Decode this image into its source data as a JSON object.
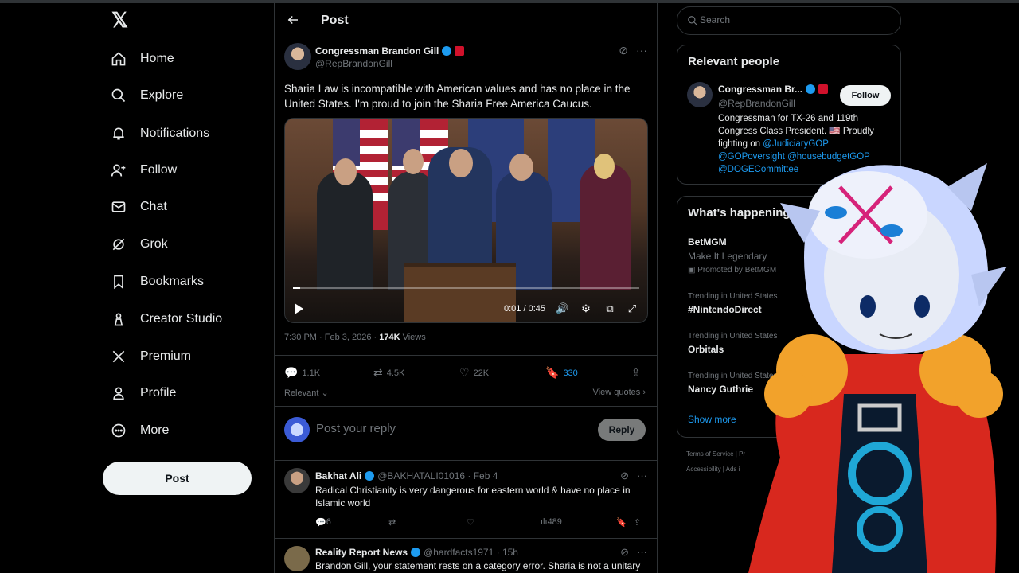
{
  "nav": {
    "items": [
      {
        "label": "Home",
        "icon": "home-icon"
      },
      {
        "label": "Explore",
        "icon": "search-icon"
      },
      {
        "label": "Notifications",
        "icon": "bell-icon"
      },
      {
        "label": "Follow",
        "icon": "person-plus-icon"
      },
      {
        "label": "Chat",
        "icon": "mail-icon"
      },
      {
        "label": "Grok",
        "icon": "grok-icon"
      },
      {
        "label": "Bookmarks",
        "icon": "bookmark-icon"
      },
      {
        "label": "Creator Studio",
        "icon": "creator-icon"
      },
      {
        "label": "Premium",
        "icon": "x-icon"
      },
      {
        "label": "Profile",
        "icon": "person-icon"
      },
      {
        "label": "More",
        "icon": "more-icon"
      }
    ],
    "post_label": "Post"
  },
  "header": {
    "title": "Post"
  },
  "post": {
    "author_name": "Congressman Brandon Gill",
    "author_handle": "@RepBrandonGill",
    "text": "Sharia Law is incompatible with American values and has no place in the United States. I'm proud to join the Sharia Free America Caucus.",
    "video_time": "0:01 / 0:45",
    "video_progress": 0.02,
    "timestamp": "7:30 PM · Feb 3, 2026 · ",
    "views_count": "174K",
    "views_label": " Views",
    "replies": "1.1K",
    "reposts": "4.5K",
    "likes": "22K",
    "bookmarks": "330",
    "sort_label": "Relevant ⌄",
    "view_quotes": "View quotes ›"
  },
  "reply": {
    "placeholder": "Post your reply",
    "button": "Reply"
  },
  "comments": [
    {
      "name": "Bakhat Ali",
      "handle": "@BAKHATALI01016 · Feb 4",
      "text": "Radical Christianity is very dangerous for eastern world & have no place in Islamic world",
      "replies": "6",
      "views": "489"
    },
    {
      "name": "Reality Report News",
      "handle": "@hardfacts1971 · 15h",
      "text": "Brandon Gill, your statement rests on a category error. Sharia is not a unitary"
    }
  ],
  "search": {
    "placeholder": "Search"
  },
  "relevant": {
    "title": "Relevant people",
    "name": "Congressman Br...",
    "handle": "@RepBrandonGill",
    "follow": "Follow",
    "bio_text": "Congressman for TX-26 and 119th Congress Class President. 🇺🇸 Proudly fighting on ",
    "bio_links": [
      "@JudiciaryGOP",
      "@GOPoversight",
      "@housebudgetGOP",
      "@DOGECommittee"
    ]
  },
  "happening": {
    "title": "What's happening",
    "ad_name": "BetMGM",
    "ad_tagline": "Make It Legendary",
    "ad_promo": "Promoted by BetMGM",
    "trends": [
      {
        "context": "Trending in United States",
        "topic": "#NintendoDirect"
      },
      {
        "context": "Trending in United States",
        "topic": "Orbitals"
      },
      {
        "context": "Trending in United States",
        "topic": "Nancy Guthrie"
      }
    ],
    "show_more": "Show more"
  },
  "footer": {
    "line1": "Terms of Service  |  Pr",
    "line2": "Accessibility  |  Ads i"
  },
  "colors": {
    "accent": "#1d9bf0",
    "background": "#000000",
    "text": "#e7e9ea",
    "muted": "#71767b",
    "border": "#2f3336"
  }
}
